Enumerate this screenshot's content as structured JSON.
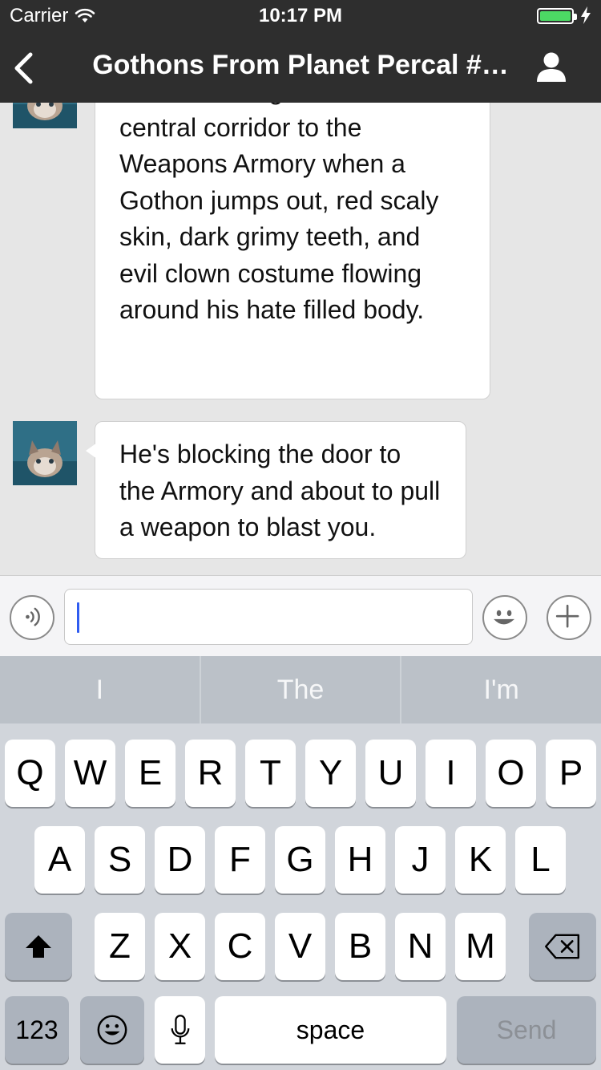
{
  "status": {
    "carrier": "Carrier",
    "time": "10:17 PM",
    "battery_level": 1.0
  },
  "nav": {
    "title": "Gothons From Planet Percal #…",
    "back_icon": "chevron-left-icon",
    "profile_icon": "person-icon"
  },
  "messages": [
    {
      "text": "You're running down the central corridor to the Weapons Armory when a Gothon jumps out, red scaly skin, dark grimy teeth, and evil clown costume flowing around his hate filled body."
    },
    {
      "text": "He's blocking the door to the Armory and about to pull a weapon to blast you."
    }
  ],
  "input": {
    "voice_icon": "voice-icon",
    "emoji_icon": "smiley-icon",
    "plus_icon": "plus-icon",
    "value": ""
  },
  "keyboard": {
    "suggestions": [
      "I",
      "The",
      "I'm"
    ],
    "row1": [
      "Q",
      "W",
      "E",
      "R",
      "T",
      "Y",
      "U",
      "I",
      "O",
      "P"
    ],
    "row2": [
      "A",
      "S",
      "D",
      "F",
      "G",
      "H",
      "J",
      "K",
      "L"
    ],
    "row3": [
      "Z",
      "X",
      "C",
      "V",
      "B",
      "N",
      "M"
    ],
    "numbers_label": "123",
    "space_label": "space",
    "send_label": "Send"
  },
  "colors": {
    "nav_bg": "#2e2e2e",
    "chat_bg": "#e6e6e6",
    "battery": "#4cd964",
    "cursor": "#2f5cf0"
  }
}
